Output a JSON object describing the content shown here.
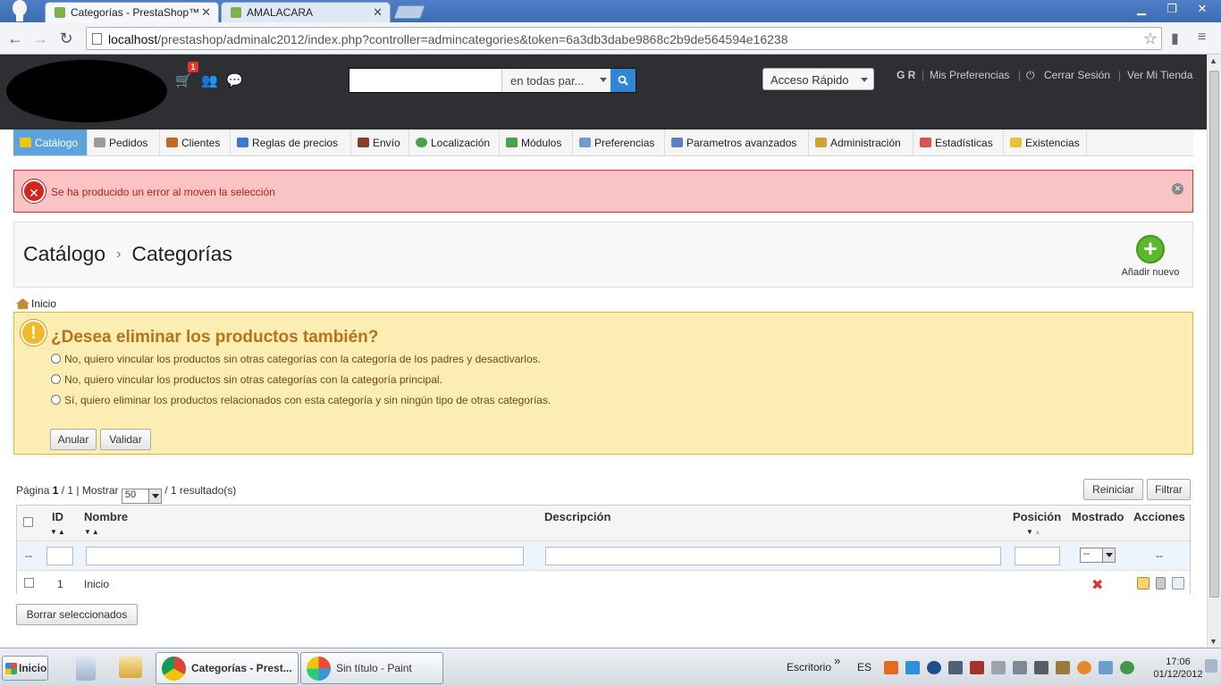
{
  "browser": {
    "tabs": [
      {
        "label": "Categorías - PrestaShop™",
        "active": true
      },
      {
        "label": "AMALACARA",
        "active": false
      }
    ],
    "url_host": "localhost",
    "url_path": "/prestashop/adminalc2012/index.php?controller=admincategories&token=6a3db3dabe9868c2b9de564594e16238"
  },
  "header": {
    "notification_count": "1",
    "search_placeholder": "",
    "search_scope": "en todas par...",
    "quick_access": "Acceso Rápido",
    "user_initials": "G R",
    "links": {
      "preferences": "Mis Preferencias",
      "logout": "Cerrar Sesión",
      "store": "Ver Mi Tienda"
    }
  },
  "menu": [
    {
      "label": "Catálogo",
      "active": true,
      "color": "#f1c40f"
    },
    {
      "label": "Pedidos",
      "color": "#888888"
    },
    {
      "label": "Clientes",
      "color": "#c0692a"
    },
    {
      "label": "Reglas de precios",
      "color": "#3f79c6"
    },
    {
      "label": "Envío",
      "color": "#8a3e2a"
    },
    {
      "label": "Localización",
      "color": "#4aa14a"
    },
    {
      "label": "Módulos",
      "color": "#4aa14a"
    },
    {
      "label": "Preferencias",
      "color": "#6f9bd1"
    },
    {
      "label": "Parametros avanzados",
      "color": "#5b7fbf"
    },
    {
      "label": "Administración",
      "color": "#d2a23a"
    },
    {
      "label": "Estadísticas",
      "color": "#d9534f"
    },
    {
      "label": "Existencias",
      "color": "#e6c13a"
    }
  ],
  "error_alert": {
    "message": "Se ha producido un error al moven la selección"
  },
  "page": {
    "breadcrumb_parent": "Catálogo",
    "breadcrumb_separator": "›",
    "title": "Categorías",
    "add_new": "Añadir nuevo",
    "home_crumb": "Inicio"
  },
  "warning": {
    "title": "¿Desea eliminar los productos también?",
    "options": [
      "No, quiero vincular los productos sin otras categorías con la categoría de los padres y desactivarlos.",
      "No, quiero vincular los productos sin otras categorías con la categoría principal.",
      "Sí, quiero eliminar los productos relacionados con esta categoría y sin ningún tipo de otras categorías."
    ],
    "cancel_label": "Anular",
    "validate_label": "Validar"
  },
  "listing": {
    "page_label": "Página",
    "page_current": "1",
    "page_total": "/ 1 | Mostrar",
    "per_page": "50",
    "results": "/ 1 resultado(s)",
    "reset_label": "Reiniciar",
    "filter_label": "Filtrar",
    "columns": {
      "id": "ID",
      "name": "Nombre",
      "description": "Descripción",
      "position": "Posición",
      "shown": "Mostrado",
      "actions": "Acciones"
    },
    "filter_placeholder_dash": "--",
    "shown_filter": "--",
    "actions_filter": "--",
    "rows": [
      {
        "id": "1",
        "name": "Inicio",
        "description": "",
        "shown": false
      }
    ],
    "bulk_delete": "Borrar seleccionados"
  },
  "taskbar": {
    "start": "Inicio",
    "tasks": [
      {
        "label": "Categorías - Prest...",
        "active": true
      },
      {
        "label": "Sin título - Paint",
        "active": false
      }
    ],
    "desktop": "Escritorio",
    "language": "ES",
    "time": "17:06",
    "date": "01/12/2012"
  }
}
